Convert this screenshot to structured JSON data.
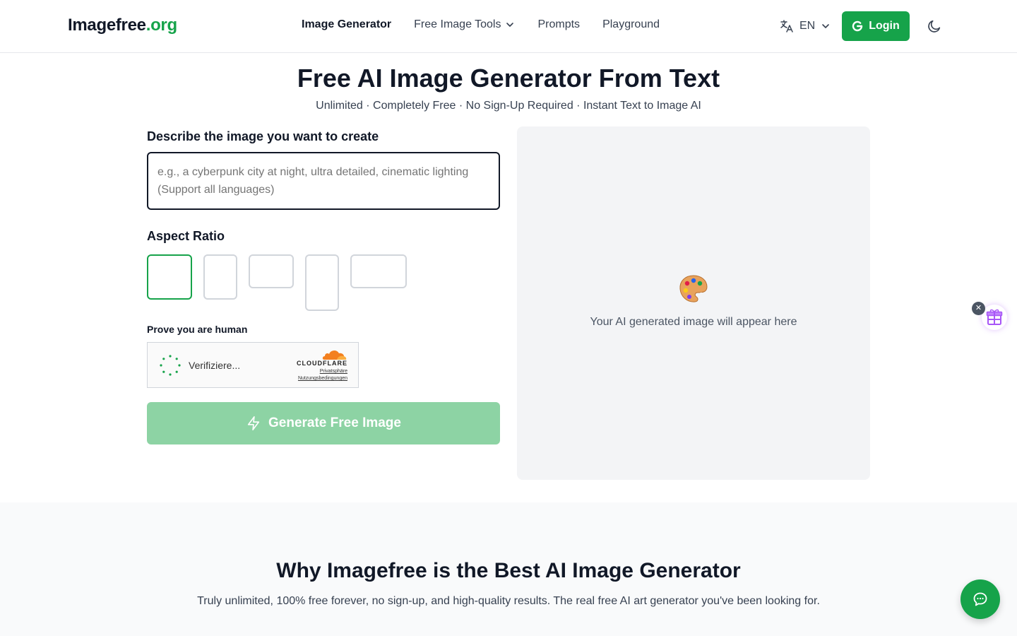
{
  "header": {
    "logo_main": "Imagefree",
    "logo_tld": ".org",
    "nav": {
      "image_generator": "Image Generator",
      "free_image_tools": "Free Image Tools",
      "prompts": "Prompts",
      "playground": "Playground"
    },
    "language": "EN",
    "login_label": "Login"
  },
  "hero": {
    "title": "Free AI Image Generator From Text",
    "subtitle": "Unlimited · Completely Free · No Sign-Up Required · Instant Text to Image AI"
  },
  "form": {
    "describe_label": "Describe the image you want to create",
    "prompt_value": "",
    "prompt_placeholder": "e.g., a cyberpunk city at night, ultra detailed, cinematic lighting (Support all languages)",
    "aspect_label": "Aspect Ratio",
    "human_label": "Prove you are human",
    "captcha": {
      "status": "Verifiziere...",
      "brand": "CLOUDFLARE",
      "privacy": "Privatsphäre",
      "terms": "Nutzungsbedingungen"
    },
    "generate_label": "Generate Free Image"
  },
  "preview": {
    "placeholder_text": "Your AI generated image will appear here"
  },
  "section2": {
    "title": "Why Imagefree is the Best AI Image Generator",
    "subtitle": "Truly unlimited, 100% free forever, no sign-up, and high-quality results. The real free AI art generator you've been looking for."
  },
  "colors": {
    "brand_green": "#16a34a",
    "button_disabled": "#8dd3a4",
    "preview_bg": "#f3f4f6"
  },
  "icons": [
    "translate-icon",
    "chevron-down-icon",
    "google-icon",
    "moon-icon",
    "zap-icon",
    "palette-icon",
    "gift-icon",
    "chat-icon",
    "close-icon"
  ]
}
